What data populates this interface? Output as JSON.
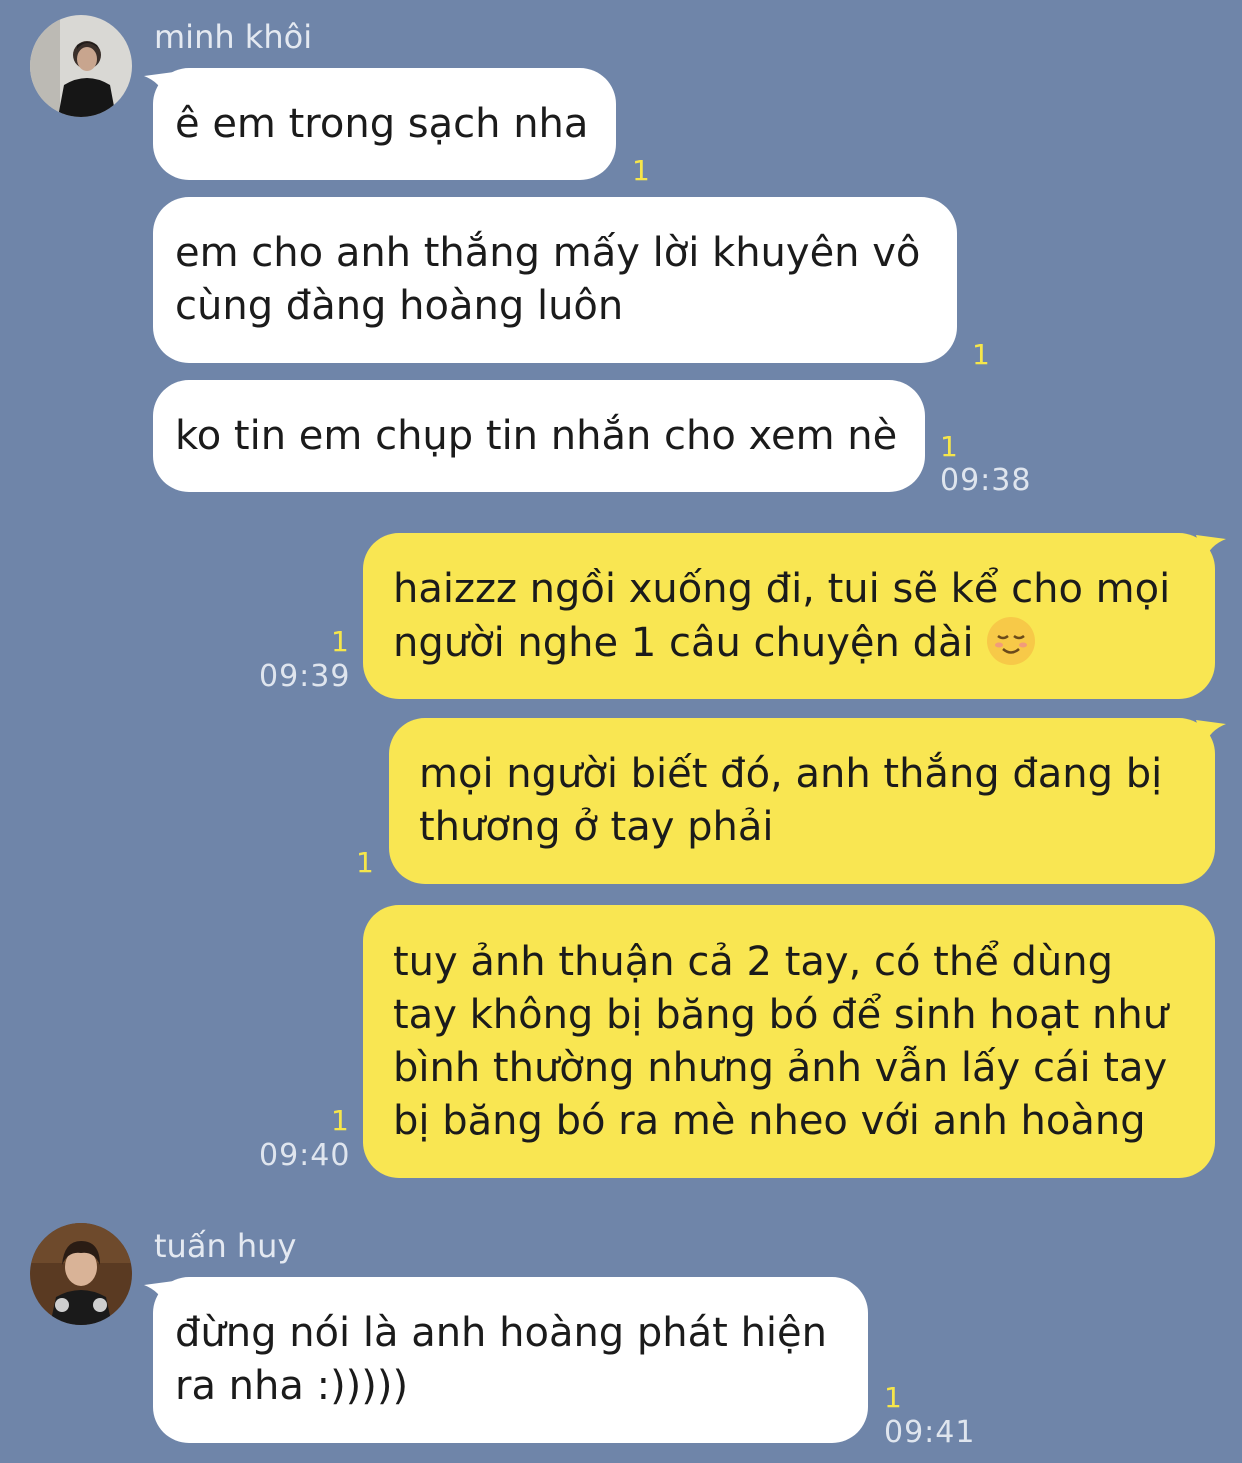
{
  "messages": [
    {
      "sender": "minh khôi",
      "text": "ê em trong sạch nha",
      "read": "1"
    },
    {
      "text": "em cho anh thắng mấy lời khuyên vô\ncùng đàng hoàng luôn",
      "read": "1"
    },
    {
      "text": "ko tin em chụp tin nhắn cho xem nè",
      "read": "1",
      "time": "09:38"
    },
    {
      "text": "haizzz ngồi xuống đi, tui sẽ kể cho mọi\nngười nghe 1 câu chuyện dài ",
      "read": "1",
      "time": "09:39",
      "emoji": "relieved-face-emoji"
    },
    {
      "text": "mọi người biết đó, anh thắng đang bị\nthương ở tay phải",
      "read": "1"
    },
    {
      "text": "tuy ảnh thuận cả 2 tay, có thể dùng\ntay không bị băng bó để sinh hoạt như\nbình thường nhưng ảnh vẫn lấy cái tay\nbị băng bó ra mè nheo với anh hoàng",
      "read": "1",
      "time": "09:40"
    },
    {
      "sender": "tuấn huy",
      "text": "đừng nói là anh hoàng phát hiện\nra nha :)))))",
      "read": "1",
      "time": "09:41"
    }
  ],
  "colors": {
    "background": "#6f85a9",
    "incoming_bubble": "#ffffff",
    "outgoing_bubble": "#f9e652",
    "read_count": "#f6e64a"
  }
}
